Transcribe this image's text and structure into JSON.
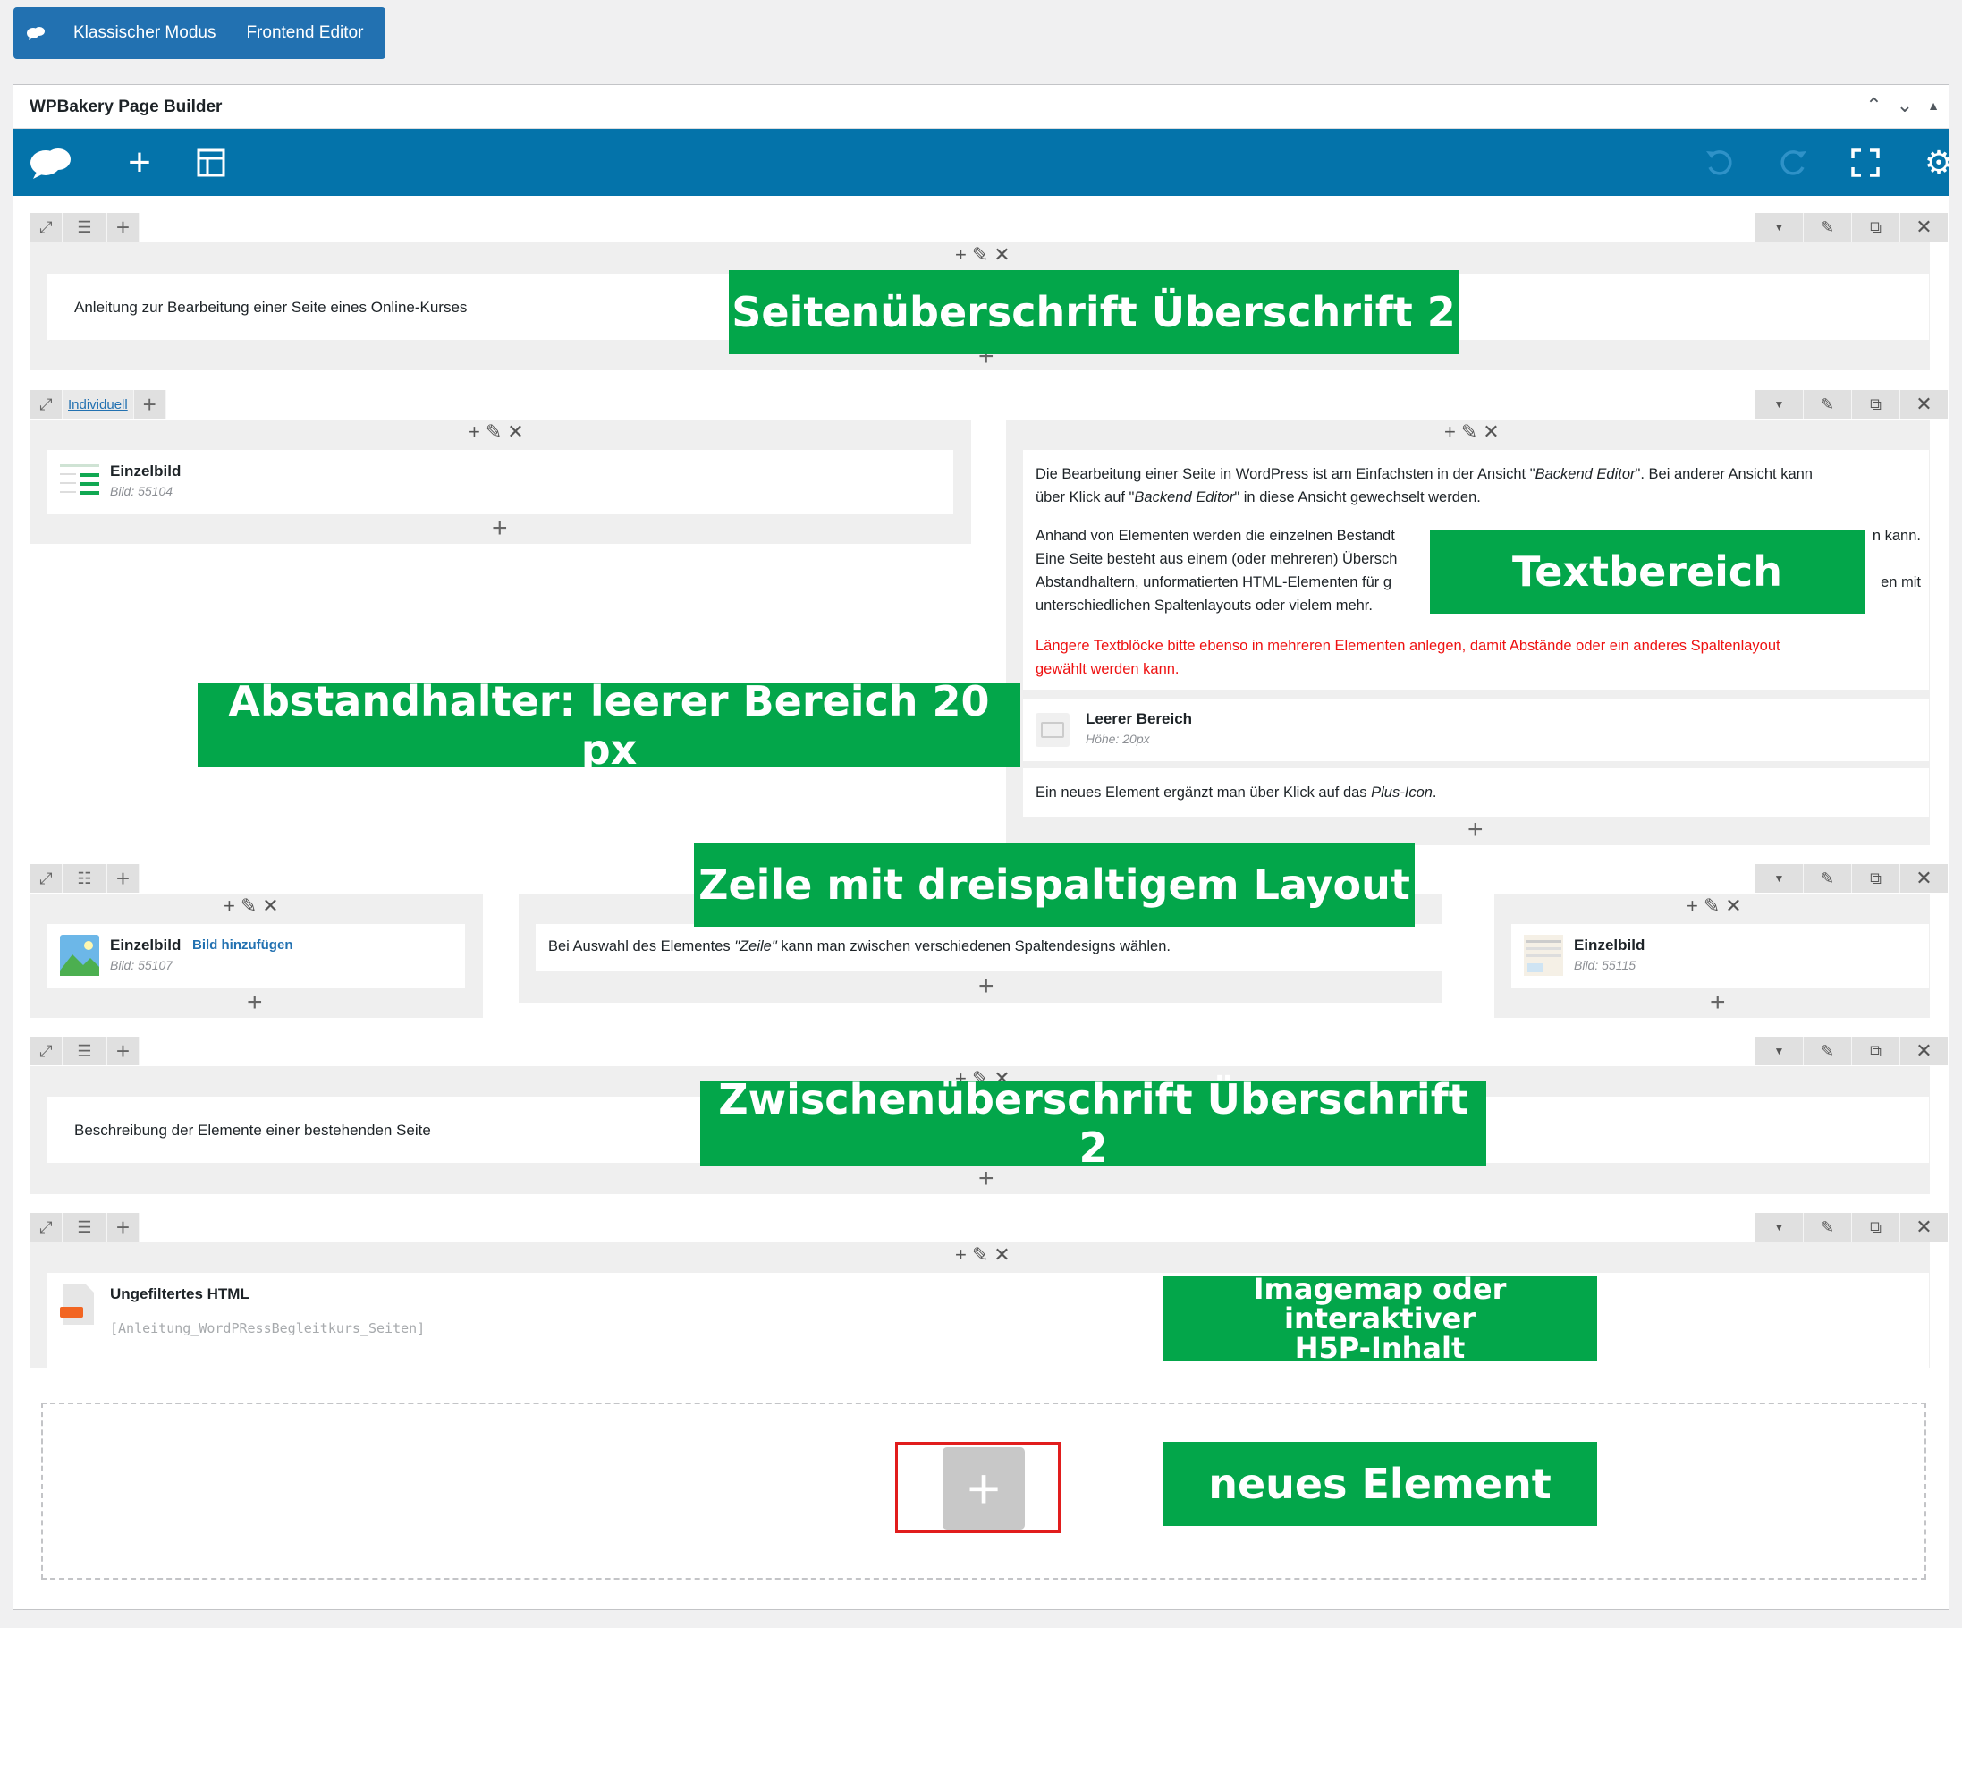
{
  "mode_bar": {
    "classic": "Klassischer Modus",
    "frontend": "Frontend Editor"
  },
  "panel": {
    "title": "WPBakery Page Builder"
  },
  "row1": {
    "heading_text": "Anleitung zur Bearbeitung einer Seite eines Online-Kurses"
  },
  "row2": {
    "layout_label": "Individuell",
    "image": {
      "name": "Einzelbild",
      "sub": "Bild: 55104"
    },
    "text_p1_a": "Die Bearbeitung einer Seite in WordPress ist am Einfachsten in der Ansicht \"",
    "text_p1_b": "Backend Editor",
    "text_p1_c": "\". Bei anderer Ansicht kann",
    "text_p1_d": "über Klick auf \"",
    "text_p1_e": "Backend Editor",
    "text_p1_f": "\" in diese Ansicht gewechselt werden.",
    "text_p2_l1a": "Anhand von Elementen werden die einzelnen Bestandt",
    "text_p2_l1b": "n kann.",
    "text_p2_l2": "Eine Seite besteht aus einem (oder mehreren) Übersch",
    "text_p2_l3a": "Abstandhaltern, unformatierten HTML-Elementen für g",
    "text_p2_l3b": "en mit",
    "text_p2_l4": "unterschiedlichen Spaltenlayouts oder vielem mehr.",
    "text_red_1": "Längere Textblöcke bitte ebenso in mehreren Elementen anlegen, damit Abstände oder ein anderes Spaltenlayout",
    "text_red_2": "gewählt werden kann.",
    "spacer": {
      "name": "Leerer Bereich",
      "sub": "Höhe: 20px"
    },
    "hint_a": "Ein neues Element ergänzt man über Klick auf das ",
    "hint_b": "Plus-Icon",
    "hint_c": "."
  },
  "row3": {
    "image1": {
      "name": "Einzelbild",
      "link": "Bild hinzufügen",
      "sub": "Bild: 55107"
    },
    "text_a": "Bei Auswahl des Elementes ",
    "text_b": "\"Zeile\"",
    "text_c": " kann man zwischen verschiedenen Spaltendesigns wählen.",
    "image2": {
      "name": "Einzelbild",
      "sub": "Bild: 55115"
    }
  },
  "row4": {
    "heading_text": "Beschreibung der Elemente einer bestehenden Seite"
  },
  "row5": {
    "html": {
      "name": "Ungefiltertes HTML",
      "code": "[Anleitung_WordPRessBegleitkurs_Seiten]"
    }
  },
  "annotations": {
    "a1": "Seitenüberschrift Überschrift 2",
    "a2": "Textbereich",
    "a3": "Abstandhalter: leerer Bereich 20 px",
    "a4": "Zeile mit dreispaltigem Layout",
    "a5": "Zwischenüberschrift Überschrift 2",
    "a6_l1": "Imagemap oder interaktiver",
    "a6_l2": "H5P-Inhalt",
    "a7": "neues Element"
  },
  "colors": {
    "toolbar": "#0473aa",
    "mode_bar": "#2271b1",
    "annotation": "#03a64a",
    "highlight": "#e11d1d"
  }
}
